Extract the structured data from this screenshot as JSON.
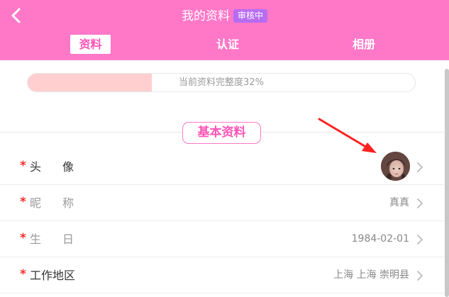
{
  "header": {
    "title": "我的资料",
    "badge": "审核中",
    "tabs": [
      {
        "label": "资料",
        "active": true
      },
      {
        "label": "认证",
        "active": false
      },
      {
        "label": "相册",
        "active": false
      }
    ]
  },
  "progress": {
    "text": "当前资料完整度32%",
    "value": 0.32
  },
  "section": {
    "title": "基本资料"
  },
  "rows": [
    {
      "required_mark": "*",
      "label_a": "头",
      "label_b": "像",
      "value": ""
    },
    {
      "required_mark": "*",
      "label_a": "昵",
      "label_b": "称",
      "value": "真真"
    },
    {
      "required_mark": "*",
      "label_a": "生",
      "label_b": "日",
      "value": "1984-02-01"
    },
    {
      "required_mark": "*",
      "label": "工作地区",
      "value": "上海 上海 崇明县"
    }
  ],
  "colors": {
    "header": "#ff78c8",
    "badge": "#b76cf2",
    "accent": "#ff55b6",
    "progress_fill": "#ffcfcf",
    "required": "#ff2a2a",
    "annotation_arrow": "#ff2020"
  },
  "icons": {
    "back": "chevron-left-icon",
    "row_chevron": "chevron-right-icon"
  }
}
